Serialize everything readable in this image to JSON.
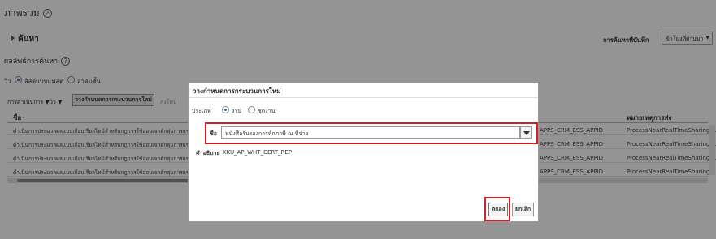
{
  "page": {
    "title": "ภาพรวม",
    "search_label": "ค้นหา",
    "saved_search_label": "การค้นหาที่บันทึก",
    "saved_search_value": "ข้าโมงที่ผ่านมา",
    "results_label": "ผลลัพธ์การค้นหา",
    "view_label": "วิว",
    "view_options": [
      "ลิสต์แบบแฟลต",
      "ลำดับชั้น"
    ]
  },
  "toolbar": {
    "actions_label": "การดำเนินการ ▼",
    "view_label": "วิว ▼",
    "schedule_button": "วางกำหนดการกระบวนการใหม่",
    "submit_button": "ส่งใหม่"
  },
  "table": {
    "columns": [
      "ชื่อ",
      "หมายเหตุการส่ง"
    ],
    "rows": [
      {
        "name": "ดำเนินการประมวลผลแบบเกือบเรียลไทม์สำหรับกฎการใช้ออบเจกต์กลุ่มการแชร์",
        "app": "APPS_CRM_ESS_APPID",
        "req": "ProcessNearRealTimeSharingRu"
      },
      {
        "name": "ดำเนินการประมวลผลแบบเกือบเรียลไทม์สำหรับกฎการใช้ออบเจกต์กลุ่มการแชร์",
        "app": "APPS_CRM_ESS_APPID",
        "req": "ProcessNearRealTimeSharingRu"
      },
      {
        "name": "ดำเนินการประมวลผลแบบเกือบเรียลไทม์สำหรับกฎการใช้ออบเจกต์กลุ่มการแชร์",
        "app": "APPS_CRM_ESS_APPID",
        "req": "ProcessNearRealTimeSharingRu"
      },
      {
        "name": "ดำเนินการประมวลผลแบบเกือบเรียลไทม์สำหรับกฎการใช้ออบเจกต์กลุ่มการแชร์",
        "app": "APPS_CRM_ESS_APPID",
        "req": "ProcessNearRealTimeSharingRu"
      }
    ]
  },
  "dialog": {
    "title": "วางกำหนดการกระบวนการใหม่",
    "type_label": "ประเภท",
    "type_options": [
      "งาน",
      "ชุดงาน"
    ],
    "name_label": "ชื่อ",
    "name_value": "หนังสือรับรองการหักภาษี ณ ที่จ่าย",
    "description_label": "คำอธิบาย",
    "description_value": "KKU_AP_WHT_CERT_REP",
    "ok_button": "ตกลง",
    "cancel_button": "ยกเลิก"
  }
}
